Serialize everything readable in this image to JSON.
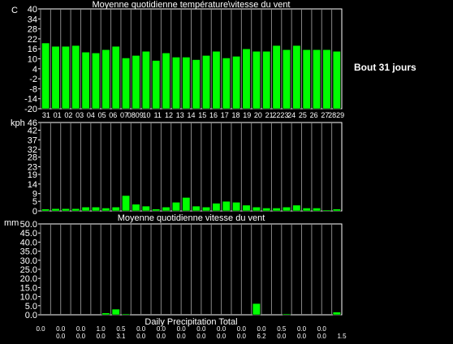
{
  "side_label": "Bout 31 jours",
  "chart_data": [
    {
      "type": "bar",
      "title": "Moyenne quotidienne température\\vitesse du vent",
      "ylabel": "C",
      "ylim": [
        -20,
        40
      ],
      "yticks": [
        40,
        34,
        28,
        22,
        16,
        10,
        4,
        -2,
        -8,
        -14,
        -20
      ],
      "ytick_labels": [
        "40",
        "34",
        "28",
        "22",
        "16",
        "10",
        "4",
        "-2",
        "-8",
        "-14",
        "-20"
      ],
      "categories": [
        "31",
        "01",
        "02",
        "03",
        "04",
        "05",
        "06",
        "07",
        "08",
        "09",
        "10",
        "11",
        "12",
        "13",
        "14",
        "15",
        "16",
        "17",
        "18",
        "19",
        "20",
        "21",
        "22",
        "23",
        "24",
        "25",
        "26",
        "27",
        "28",
        "29"
      ],
      "xtick_labels": [
        "31",
        "01",
        "02",
        "03",
        "04",
        "05",
        "06",
        "07",
        "0809",
        "10",
        "11",
        "12",
        "13",
        "14",
        "15",
        "16",
        "17",
        "18",
        "19",
        "20",
        "21",
        "2223",
        "24",
        "25",
        "26",
        "27",
        "2829"
      ],
      "values": [
        19.5,
        17.5,
        17.5,
        18,
        14,
        13.5,
        15.5,
        17.5,
        10.5,
        12,
        14.5,
        9,
        13.5,
        11,
        11,
        9.5,
        12,
        14.5,
        10.5,
        11.5,
        16,
        14.5,
        14.5,
        18,
        15.5,
        18,
        15.5,
        15.5,
        15.5,
        14.5
      ],
      "bar_color": "#00ff00",
      "grid": false
    },
    {
      "type": "bar",
      "title": "",
      "ylabel": "kph",
      "ylim": [
        0,
        46
      ],
      "yticks": [
        46,
        42,
        37,
        32,
        28,
        23,
        19,
        14,
        9,
        5,
        0
      ],
      "ytick_labels": [
        "46",
        "42",
        "37",
        "32",
        "28",
        "23",
        "19",
        "14",
        "9",
        "5",
        "0"
      ],
      "categories": [
        "31",
        "01",
        "02",
        "03",
        "04",
        "05",
        "06",
        "07",
        "08",
        "09",
        "10",
        "11",
        "12",
        "13",
        "14",
        "15",
        "16",
        "17",
        "18",
        "19",
        "20",
        "21",
        "22",
        "23",
        "24",
        "25",
        "26",
        "27",
        "28",
        "29"
      ],
      "values": [
        1,
        1.2,
        1.2,
        1.2,
        2,
        2,
        1.5,
        2,
        8,
        3.5,
        2.5,
        1,
        2,
        4.5,
        7,
        2.5,
        2,
        4,
        5,
        4.5,
        3,
        2,
        1.5,
        1.5,
        2,
        3,
        1.5,
        1.5,
        0.5,
        1
      ],
      "bar_color": "#00ff00",
      "grid": false
    },
    {
      "type": "bar",
      "title": "Moyenne quotidienne vitesse du vent",
      "xlabel": "Daily Precipitation Total",
      "ylabel": "mm",
      "ylim": [
        0,
        50
      ],
      "yticks": [
        50,
        45,
        40,
        35,
        30,
        25,
        20,
        15,
        10,
        5,
        0
      ],
      "ytick_labels": [
        "50.0",
        "45.0",
        "40.0",
        "35.0",
        "30.0",
        "25.0",
        "20.0",
        "15.0",
        "10.0",
        "5.0",
        "0.0"
      ],
      "categories": [
        "31",
        "01",
        "02",
        "03",
        "04",
        "05",
        "06",
        "07",
        "08",
        "09",
        "10",
        "11",
        "12",
        "13",
        "14",
        "15",
        "16",
        "17",
        "18",
        "19",
        "20",
        "21",
        "22",
        "23",
        "24",
        "25",
        "26",
        "27",
        "28",
        "29"
      ],
      "values": [
        0.0,
        0.0,
        0.0,
        0.0,
        0.0,
        0.0,
        1.0,
        3.1,
        0.5,
        0.0,
        0.0,
        0.0,
        0.0,
        0.0,
        0.0,
        0.0,
        0.0,
        0.0,
        0.0,
        0.0,
        0.0,
        6.2,
        0.0,
        0.0,
        0.5,
        0.0,
        0.0,
        0.0,
        0.0,
        1.5
      ],
      "data_labels": [
        "0.0",
        "0.0",
        "0.0",
        "0.0",
        "0.0",
        "0.0",
        "1.0",
        "3.1",
        "0.5",
        "0.0",
        "0.0",
        "0.0",
        "0.0",
        "0.0",
        "0.0",
        "0.0",
        "0.0",
        "0.0",
        "0.0",
        "0.0",
        "0.0",
        "6.2",
        "0.0",
        "0.0",
        "0.5",
        "0.0",
        "0.0",
        "0.0",
        "0.0",
        "1.5"
      ],
      "bar_color": "#00ff00",
      "grid": false
    }
  ]
}
